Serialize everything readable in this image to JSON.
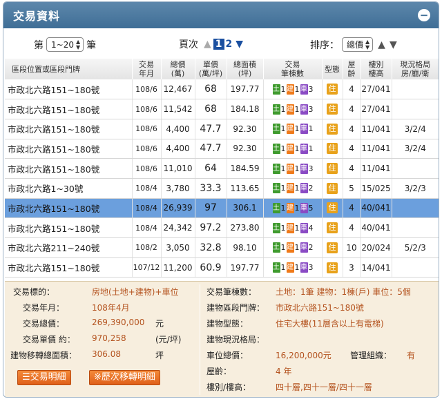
{
  "window": {
    "title": "交易資料",
    "close_symbol": "−"
  },
  "controls": {
    "page_prefix": "第",
    "range_value": "1~20",
    "page_suffix": "筆",
    "page_label": "頁次",
    "pages": [
      "1",
      "2"
    ],
    "current_page": "1",
    "sort_label": "排序：",
    "sort_value": "總價"
  },
  "table": {
    "headers": [
      "區段位置或區段門牌",
      "交易\n年月",
      "總價\n(萬)",
      "單價\n(萬/坪)",
      "總面積\n(坪)",
      "交易\n筆棟數",
      "型態",
      "屋\n齡",
      "樓別\n樓高",
      "現況格局\n房/廳/衛"
    ],
    "rows": [
      {
        "addr": "市政北六路151~180號",
        "ym": "108/6",
        "total": "12,467",
        "unit": "68",
        "area": "197.77",
        "land": "1",
        "build": "1",
        "park": "3",
        "type": "住",
        "age": "4",
        "floor": "27/041",
        "layout": "",
        "selected": false
      },
      {
        "addr": "市政北六路151~180號",
        "ym": "108/6",
        "total": "11,542",
        "unit": "68",
        "area": "184.18",
        "land": "1",
        "build": "1",
        "park": "3",
        "type": "住",
        "age": "4",
        "floor": "27/041",
        "layout": "",
        "selected": false
      },
      {
        "addr": "市政北六路151~180號",
        "ym": "108/6",
        "total": "4,400",
        "unit": "47.7",
        "area": "92.30",
        "land": "1",
        "build": "1",
        "park": "1",
        "type": "住",
        "age": "4",
        "floor": "11/041",
        "layout": "3/2/4",
        "selected": false
      },
      {
        "addr": "市政北六路151~180號",
        "ym": "108/6",
        "total": "4,400",
        "unit": "47.7",
        "area": "92.30",
        "land": "1",
        "build": "1",
        "park": "1",
        "type": "住",
        "age": "4",
        "floor": "11/041",
        "layout": "3/2/4",
        "selected": false
      },
      {
        "addr": "市政北六路151~180號",
        "ym": "108/6",
        "total": "11,010",
        "unit": "64",
        "area": "184.59",
        "land": "1",
        "build": "1",
        "park": "3",
        "type": "住",
        "age": "4",
        "floor": "11/041",
        "layout": "",
        "selected": false
      },
      {
        "addr": "市政北六路1~30號",
        "ym": "108/4",
        "total": "3,780",
        "unit": "33.3",
        "area": "113.65",
        "land": "1",
        "build": "1",
        "park": "2",
        "type": "住",
        "age": "5",
        "floor": "15/025",
        "layout": "3/2/3",
        "selected": false
      },
      {
        "addr": "市政北六路151~180號",
        "ym": "108/4",
        "total": "26,939",
        "unit": "97",
        "area": "306.1",
        "land": "1",
        "build": "1",
        "park": "5",
        "type": "住",
        "age": "4",
        "floor": "40/041",
        "layout": "",
        "selected": true
      },
      {
        "addr": "市政北六路151~180號",
        "ym": "108/4",
        "total": "24,342",
        "unit": "97.2",
        "area": "273.80",
        "land": "1",
        "build": "1",
        "park": "4",
        "type": "住",
        "age": "4",
        "floor": "40/041",
        "layout": "",
        "selected": false
      },
      {
        "addr": "市政北六路211~240號",
        "ym": "108/2",
        "total": "3,050",
        "unit": "32.8",
        "area": "98.10",
        "land": "1",
        "build": "1",
        "park": "2",
        "type": "住",
        "age": "10",
        "floor": "20/024",
        "layout": "5/2/3",
        "selected": false
      },
      {
        "addr": "市政北六路151~180號",
        "ym": "107/12",
        "total": "11,200",
        "unit": "60.9",
        "area": "197.77",
        "land": "1",
        "build": "1",
        "park": "3",
        "type": "住",
        "age": "3",
        "floor": "14/041",
        "layout": "",
        "selected": false
      }
    ],
    "badges": {
      "land": "土",
      "build": "建",
      "park": "車"
    }
  },
  "detail": {
    "target_label": "交易標的：",
    "target_value": "房地(土地+建物)+車位",
    "ym_label": "交易年月：",
    "ym_value": "108年4月",
    "total_label": "交易總價：",
    "total_value": "269,390,000",
    "total_unit": "元",
    "unit_label": "交易單價 約：",
    "unit_value": "970,258",
    "unit_unit": "(元/坪)",
    "area_label": "建物移轉總面積：",
    "area_value": "306.08",
    "area_unit": "坪",
    "count_label": "交易筆棟數：",
    "count_value": "土地：1筆 建物：1棟(戶) 車位：5個",
    "addr_label": "建物區段門牌：",
    "addr_value": "市政北六路151~180號",
    "type_label": "建物型態：",
    "type_value": "住宅大樓(11層含以上有電梯)",
    "layout_label": "建物現況格局：",
    "layout_value": "",
    "park_label": "車位總價：",
    "park_value": "16,200,000元",
    "mgmt_label": "管理組織：",
    "mgmt_value": "有",
    "age_label": "屋齡：",
    "age_value": "4 年",
    "floor_label": "樓別/樓高：",
    "floor_value": "四十層,四十一層/四十一層",
    "btn_detail": "☰交易明細",
    "btn_history": "※歷次移轉明細"
  }
}
